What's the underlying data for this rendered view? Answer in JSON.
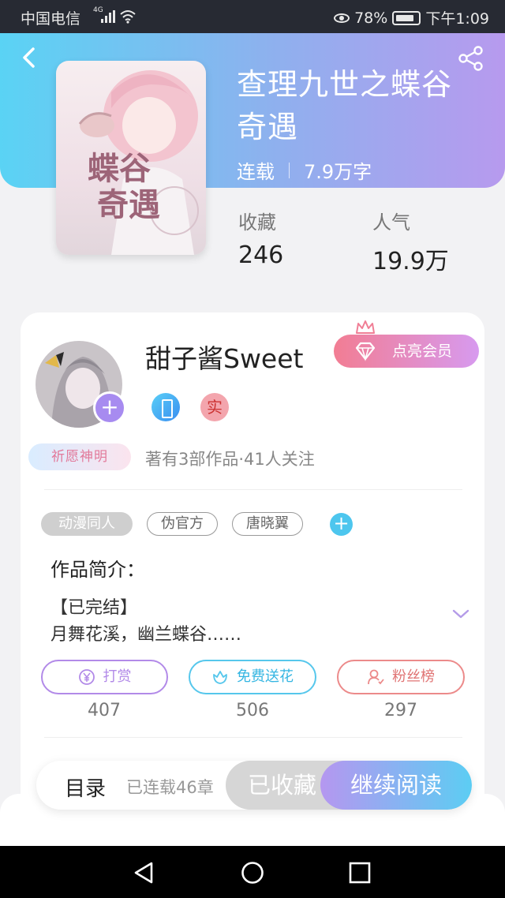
{
  "status_bar": {
    "carrier": "中国电信",
    "signal": "4G",
    "battery": "78%",
    "time": "下午1:09"
  },
  "header": {
    "back_icon": "back-arrow-icon",
    "share_icon": "share-icon"
  },
  "book": {
    "title": "查理九世之蝶谷奇遇",
    "status": "连载",
    "word_count": "7.9万字",
    "stats": [
      {
        "label": "收藏",
        "value": "246"
      },
      {
        "label": "人气",
        "value": "19.9万"
      }
    ],
    "cover": {
      "main_text": "蝶谷奇遇",
      "accent": "#e7b8c9"
    }
  },
  "author": {
    "name": "甜子酱Sweet",
    "vip_button": "点亮会员",
    "wish_badge": "祈愿神明",
    "badge_real": "实",
    "info": "著有3部作品·41人关注",
    "follow_icon": "plus-icon"
  },
  "tags": [
    "动漫同人",
    "伪官方",
    "唐晓翼"
  ],
  "intro": {
    "title": "作品简介：",
    "line1": "【已完结】",
    "line2": "月舞花溪，幽兰蝶谷……"
  },
  "actions": [
    {
      "label": "打赏",
      "count": "407",
      "color": "#b28ae8",
      "icon": "yen-icon"
    },
    {
      "label": "免费送花",
      "count": "506",
      "color": "#56c7ec",
      "icon": "flower-icon"
    },
    {
      "label": "粉丝榜",
      "count": "297",
      "color": "#ec8a8a",
      "icon": "fans-icon"
    }
  ],
  "bottom_bar": {
    "toc_label": "目录",
    "toc_status": "已连载46章",
    "collect_label": "已收藏",
    "read_label": "继续阅读"
  },
  "colors": {
    "gradient_start": "#5ad3f4",
    "gradient_end": "#b79aee",
    "vip_start": "#f27d93",
    "vip_end": "#d79aef"
  }
}
